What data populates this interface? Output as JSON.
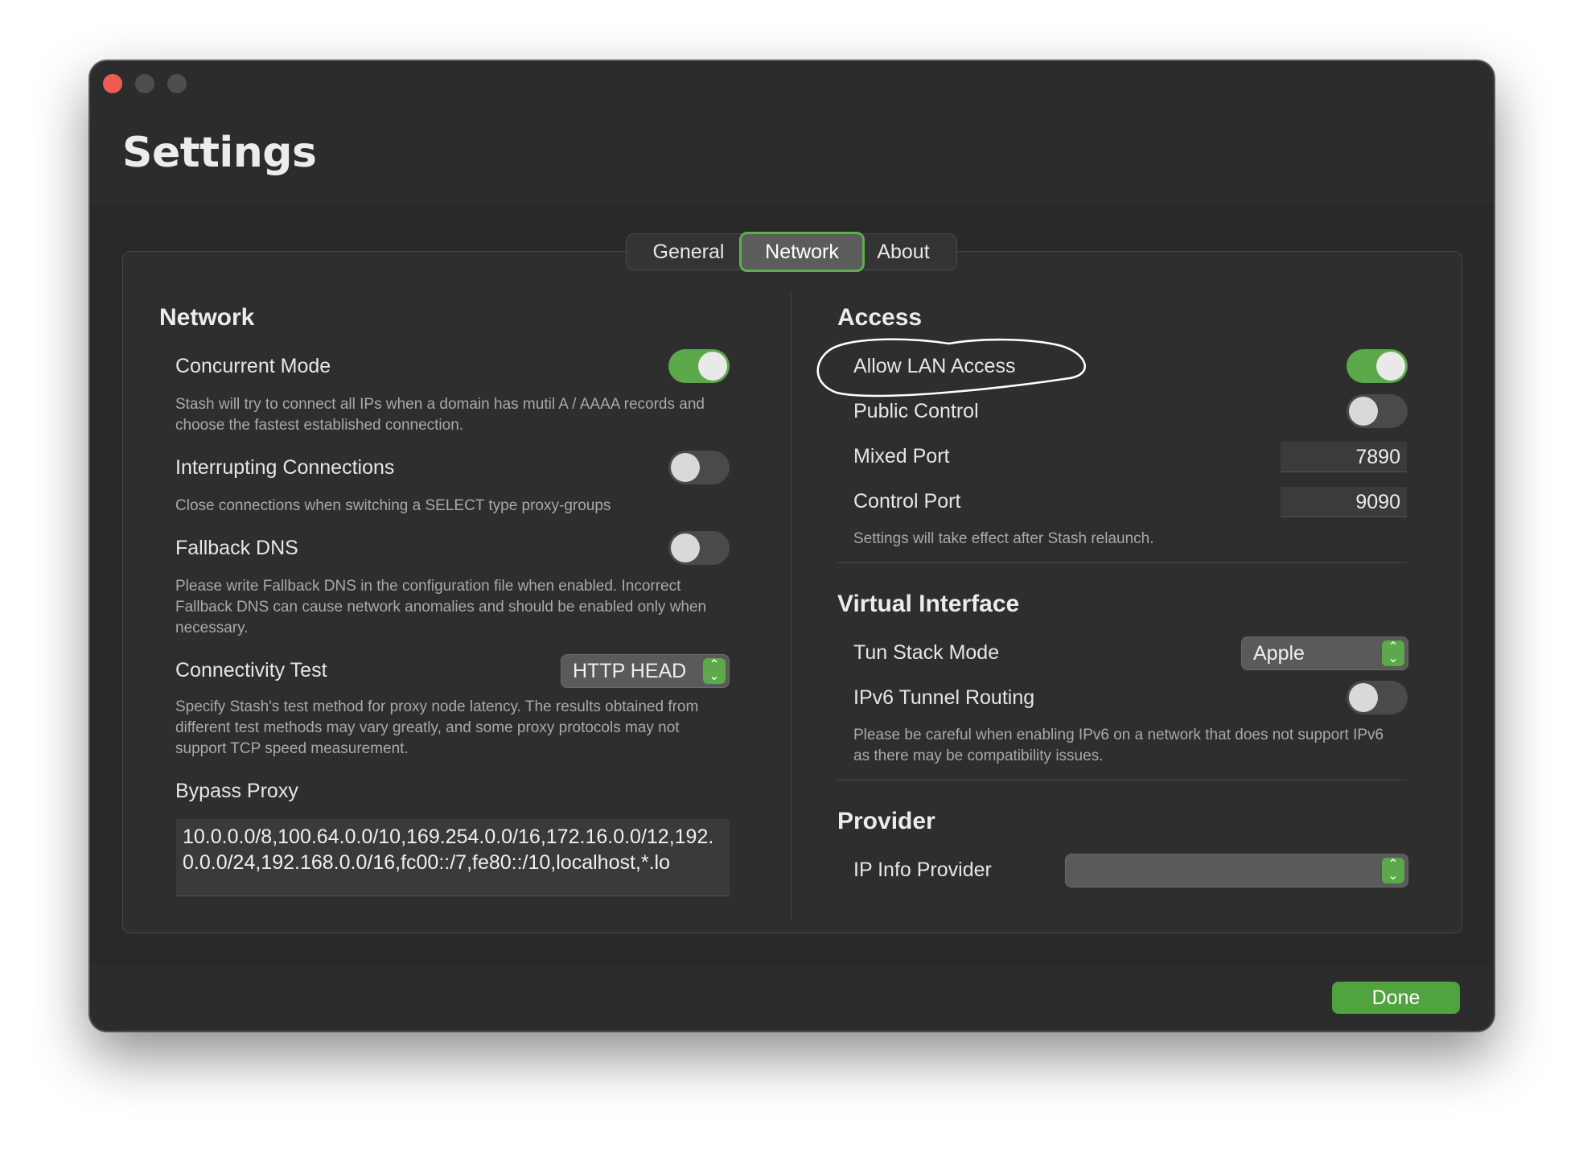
{
  "window": {
    "title": "Settings"
  },
  "tabs": {
    "general": "General",
    "network": "Network",
    "about": "About",
    "selected": "Network"
  },
  "network_section": {
    "title": "Network",
    "concurrent_mode": {
      "label": "Concurrent Mode",
      "enabled": true,
      "description": "Stash will try to connect all IPs when a domain has mutil A / AAAA records and choose the fastest established connection."
    },
    "interrupting_connections": {
      "label": "Interrupting Connections",
      "enabled": false,
      "description": "Close connections when switching a SELECT type proxy-groups"
    },
    "fallback_dns": {
      "label": "Fallback DNS",
      "enabled": false,
      "description": "Please write Fallback DNS in the configuration file when enabled. Incorrect Fallback DNS can cause network anomalies and should be enabled only when necessary."
    },
    "connectivity_test": {
      "label": "Connectivity Test",
      "value": "HTTP HEAD",
      "description": "Specify Stash's test method for proxy node latency. The results obtained from different test methods may vary greatly, and some proxy protocols may not support TCP speed measurement."
    },
    "bypass_proxy": {
      "label": "Bypass Proxy",
      "value": "10.0.0.0/8,100.64.0.0/10,169.254.0.0/16,172.16.0.0/12,192.0.0.0/24,192.168.0.0/16,fc00::/7,fe80::/10,localhost,*.lo"
    }
  },
  "access_section": {
    "title": "Access",
    "allow_lan_access": {
      "label": "Allow LAN Access",
      "enabled": true
    },
    "public_control": {
      "label": "Public Control",
      "enabled": false
    },
    "mixed_port": {
      "label": "Mixed Port",
      "value": "7890"
    },
    "control_port": {
      "label": "Control Port",
      "value": "9090"
    },
    "note": "Settings will take effect after Stash relaunch."
  },
  "virtual_interface_section": {
    "title": "Virtual Interface",
    "tun_stack_mode": {
      "label": "Tun Stack Mode",
      "value": "Apple"
    },
    "ipv6_tunnel_routing": {
      "label": "IPv6 Tunnel Routing",
      "enabled": false
    },
    "description": "Please be careful when enabling IPv6 on a network that does not support IPv6 as there may be compatibility issues."
  },
  "provider_section": {
    "title": "Provider",
    "ip_info_provider": {
      "label": "IP Info Provider",
      "value": ""
    }
  },
  "footer": {
    "done_label": "Done"
  },
  "colors": {
    "accent": "#5ba94a",
    "close": "#ee5c52",
    "window_bg": "#2c2c2c"
  },
  "icons": {
    "popup_chevrons": "chevron-up-down-icon"
  }
}
